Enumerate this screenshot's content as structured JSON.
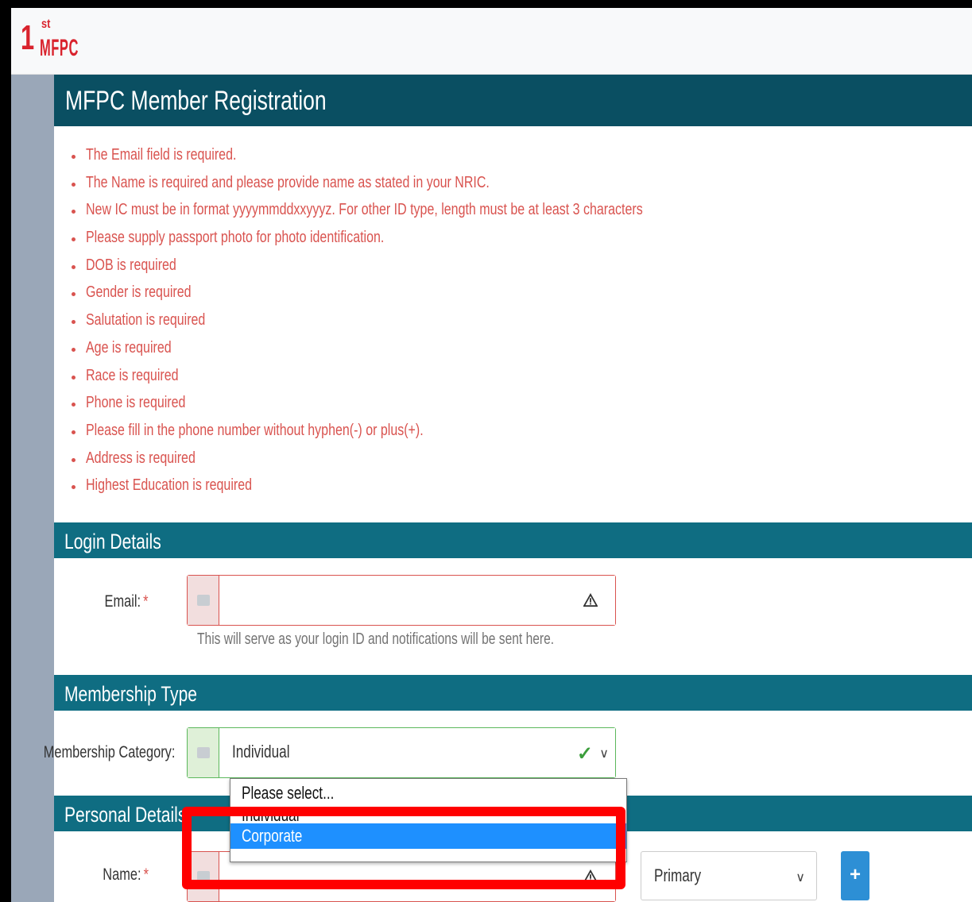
{
  "logo": {
    "sup": "st",
    "number": "1",
    "text": "MFPC"
  },
  "page": {
    "title": "MFPC Member Registration"
  },
  "errors": [
    "The Email field is required.",
    "The Name is required and please provide name as stated in your NRIC.",
    "New IC must be in format yyyymmddxxyyyz. For other ID type, length must be at least 3 characters",
    "Please supply passport photo for photo identification.",
    "DOB is required",
    "Gender is required",
    "Salutation is required",
    "Age is required",
    "Race is required",
    "Phone is required",
    "Please fill in the phone number without hyphen(-) or plus(+).",
    "Address is required",
    "Highest Education is required"
  ],
  "sections": {
    "login": "Login Details",
    "membership": "Membership Type",
    "personal": "Personal Details"
  },
  "email": {
    "label": "Email:",
    "required_mark": "*",
    "value": "",
    "help": "This will serve as your login ID and notifications will be sent here."
  },
  "membership_category": {
    "label": "Membership Category:",
    "selected": "Individual",
    "options": [
      "Please select...",
      "Individual",
      "Corporate"
    ],
    "highlighted_option": "Corporate"
  },
  "name": {
    "label": "Name:",
    "required_mark": "*",
    "value": "",
    "name_type": "Primary",
    "add_label": "+"
  },
  "colors": {
    "error": "#d9534f",
    "header": "#0a4f62",
    "section": "#0f6d82",
    "sidebar": "#9aa7b8",
    "highlight": "#ff0000",
    "selected_option": "#1e90ff"
  }
}
